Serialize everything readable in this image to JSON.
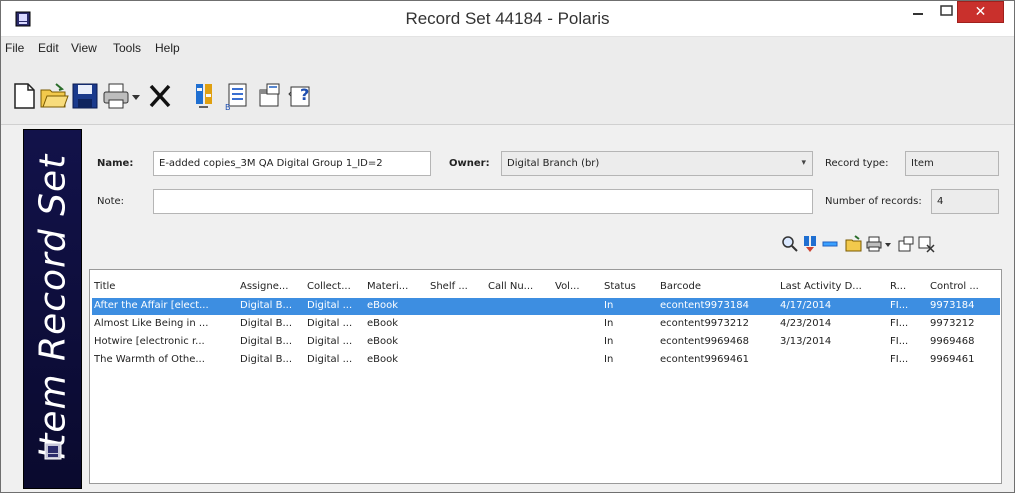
{
  "window": {
    "title": "Record Set 44184 -  Polaris"
  },
  "window_controls": {
    "minimize": "–",
    "maximize": "☐",
    "close": "✕"
  },
  "menu": [
    "File",
    "Edit",
    "View",
    "Tools",
    "Help"
  ],
  "toolbar_icons": [
    "new-document-icon",
    "open-folder-icon",
    "save-icon",
    "print-icon",
    "dropdown-arrow-icon",
    "delete-icon",
    "bulk-change-icon",
    "report-icon",
    "properties-icon",
    "help-icon"
  ],
  "sidebar": {
    "title": "Item Record Set"
  },
  "form": {
    "name_label": "Name:",
    "name_value": "E-added copies_3M QA Digital Group 1_ID=2",
    "owner_label": "Owner:",
    "owner_value": "Digital Branch (br)",
    "record_type_label": "Record type:",
    "record_type_value": "Item",
    "note_label": "Note:",
    "note_value": "",
    "count_label": "Number of records:",
    "count_value": "4"
  },
  "list": {
    "columns": [
      "Title",
      "Assigne...",
      "Collect...",
      "Materi...",
      "Shelf ...",
      "Call Nu...",
      "Vol...",
      "Status",
      "Barcode",
      "Last Activity D...",
      "R...",
      "Control ..."
    ],
    "rows": [
      [
        "After the Affair [elect...",
        "Digital B...",
        "Digital ...",
        "eBook",
        "",
        "",
        "",
        "In",
        "econtent9973184",
        "4/17/2014",
        "FI...",
        "9973184"
      ],
      [
        "Almost Like Being in ...",
        "Digital B...",
        "Digital ...",
        "eBook",
        "",
        "",
        "",
        "In",
        "econtent9973212",
        "4/23/2014",
        "FI...",
        "9973212"
      ],
      [
        "Hotwire [electronic r...",
        "Digital B...",
        "Digital ...",
        "eBook",
        "",
        "",
        "",
        "In",
        "econtent9969468",
        "3/13/2014",
        "FI...",
        "9969468"
      ],
      [
        "The Warmth of Othe...",
        "Digital B...",
        "Digital ...",
        "eBook",
        "",
        "",
        "",
        "In",
        "econtent9969461",
        "",
        "FI...",
        "9969461"
      ]
    ],
    "selected_row": 0
  },
  "colors": {
    "selection": "#3d8ee1",
    "sidebar": "#0f0f3f",
    "close_button": "#c9302c"
  }
}
